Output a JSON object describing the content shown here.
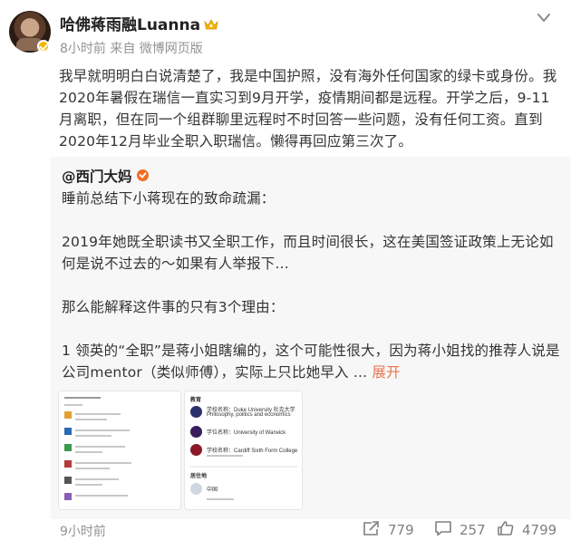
{
  "post": {
    "author": "哈佛蒋雨融Luanna",
    "meta": "8小时前 来自 微博网页版",
    "text": "我早就明明白白说清楚了，我是中国护照，没有海外任何国家的绿卡或身份。我2020年暑假在瑞信一直实习到9月开学，疫情期间都是远程。开学之后，9-11月离职，但在同一个组群聊里远程时不时回答一些问题，没有任何工资。直到2020年12月毕业全职入职瑞信。懒得再回应第三次了。",
    "time": "9小时前"
  },
  "retweet": {
    "author": "@西门大妈",
    "paragraphs": [
      "睡前总结下小蒋现在的致命疏漏：",
      "2019年她既全职读书又全职工作，而且时间很长，这在美国签证政策上无论如何是说不过去的～如果有人举报下...",
      "那么能解释这件事的只有3个理由：",
      "1 领英的“全职”是蒋小姐瞎编的，这个可能性很大，因为蒋小姐找的推荐人说是公司mentor（类似师傅），实际上只比她早入 ..."
    ],
    "expand_label": "展开"
  },
  "thumb2": {
    "section_label": "教育",
    "rows": [
      "学校名称：Duke University 杜克大学",
      "Philosophy, politics and economics",
      "学位名称：University of Warwick",
      "学校名称：Cardiff Sixth Form College"
    ],
    "footer_label": "居住地",
    "footer_value": "中国"
  },
  "actions": {
    "forward_count": "779",
    "comment_count": "257",
    "like_count": "4799"
  },
  "colors": {
    "accent": "#eb7350",
    "meta_gray": "#939393",
    "crown_gold": "#f6b400",
    "rt_bg": "#f7f7f7"
  },
  "icons": [
    "crown-icon",
    "more-menu-icon",
    "verified-badge-icon",
    "forward-icon",
    "comment-icon",
    "like-icon"
  ]
}
